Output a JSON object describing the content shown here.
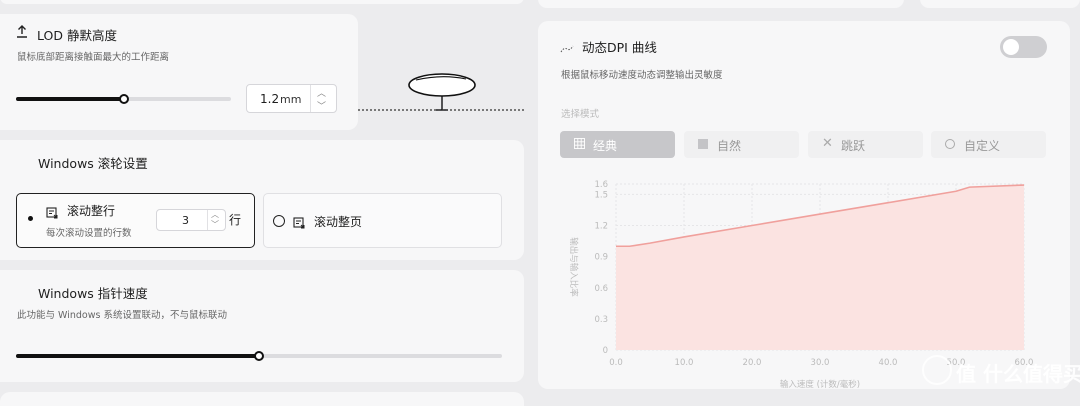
{
  "lod": {
    "title": "LOD 静默高度",
    "description": "鼠标底部距离接触面最大的工作距离",
    "value": "1.2",
    "unit": "mm",
    "slider_level": 0.5
  },
  "scroll": {
    "title": "Windows 滚轮设置",
    "option_line": {
      "label": "滚动整行",
      "description": "每次滚动设置的行数",
      "value": "3",
      "unit": "行",
      "selected": true
    },
    "option_page": {
      "label": "滚动整页",
      "selected": false
    }
  },
  "pointer": {
    "title": "Windows 指针速度",
    "description": "此功能与 Windows 系统设置联动，不与鼠标联动",
    "slider_level": 0.5
  },
  "dpi_curve": {
    "title": "动态DPI 曲线",
    "description": "根据鼠标移动速度动态调整输出灵敏度",
    "toggle_on": false,
    "mode_label": "选择模式",
    "modes": [
      {
        "label": "经典",
        "active": true
      },
      {
        "label": "自然",
        "active": false
      },
      {
        "label": "跳跃",
        "active": false
      },
      {
        "label": "自定义",
        "active": false
      }
    ]
  },
  "watermark": "值 什么值得买",
  "chart_data": {
    "type": "area",
    "title": "",
    "xlabel": "输入速度 (计数/毫秒)",
    "ylabel": "输出与输入比率",
    "x_ticks": [
      "0.0",
      "10.0",
      "20.0",
      "30.0",
      "40.0",
      "50.0",
      "60.0"
    ],
    "y_ticks": [
      "0",
      "0.3",
      "0.6",
      "0.9",
      "1.2",
      "1.5",
      "1.6"
    ],
    "xlim": [
      0,
      60
    ],
    "ylim": [
      0,
      1.6
    ],
    "series": [
      {
        "x": [
          0,
          2,
          5,
          10,
          20,
          30,
          40,
          50,
          52,
          60
        ],
        "y": [
          1.0,
          1.0,
          1.03,
          1.09,
          1.2,
          1.31,
          1.42,
          1.53,
          1.57,
          1.59
        ]
      }
    ],
    "color": "#f0a09c",
    "fill": "#fbe3e1",
    "grid": true
  }
}
